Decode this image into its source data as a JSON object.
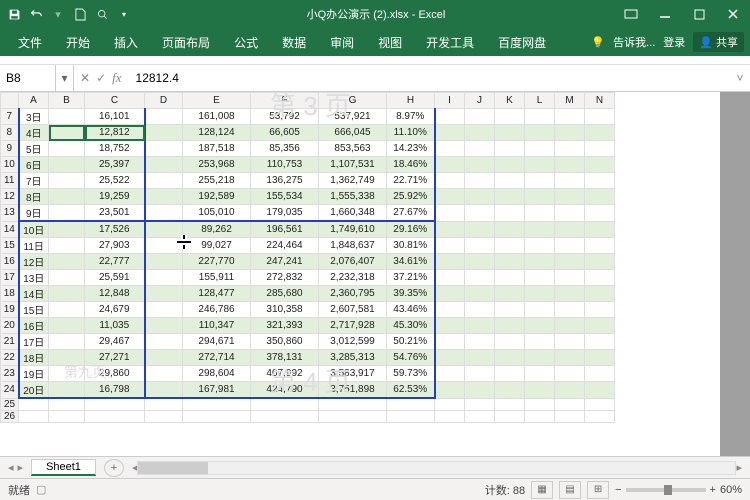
{
  "app": {
    "title": "小Q办公演示 (2).xlsx - Excel"
  },
  "tabs": {
    "file": "文件",
    "home": "开始",
    "insert": "插入",
    "layout": "页面布局",
    "formulas": "公式",
    "data": "数据",
    "review": "审阅",
    "view": "视图",
    "dev": "开发工具",
    "baidu": "百度网盘",
    "tellme": "告诉我...",
    "login": "登录",
    "share": "共享"
  },
  "namebox": "B8",
  "formula": "12812.4",
  "columns": [
    "A",
    "B",
    "C",
    "D",
    "E",
    "F",
    "G",
    "H",
    "I",
    "J",
    "K",
    "L",
    "M",
    "N"
  ],
  "rowNums": [
    7,
    8,
    9,
    10,
    11,
    12,
    13,
    14,
    15,
    16,
    17,
    18,
    19,
    20,
    21,
    22,
    23,
    24,
    25,
    26
  ],
  "rows": [
    {
      "A": "3日",
      "C": "16,101",
      "E": "161,008",
      "F": "53,792",
      "G": "537,921",
      "H": "8.97%",
      "even": false
    },
    {
      "A": "4日",
      "C": "12,812",
      "E": "128,124",
      "F": "66,605",
      "G": "666,045",
      "H": "11.10%",
      "even": true
    },
    {
      "A": "5日",
      "C": "18,752",
      "E": "187,518",
      "F": "85,356",
      "G": "853,563",
      "H": "14.23%",
      "even": false
    },
    {
      "A": "6日",
      "C": "25,397",
      "E": "253,968",
      "F": "110,753",
      "G": "1,107,531",
      "H": "18.46%",
      "even": true
    },
    {
      "A": "7日",
      "C": "25,522",
      "E": "255,218",
      "F": "136,275",
      "G": "1,362,749",
      "H": "22.71%",
      "even": false
    },
    {
      "A": "8日",
      "C": "19,259",
      "E": "192,589",
      "F": "155,534",
      "G": "1,555,338",
      "H": "25.92%",
      "even": true
    },
    {
      "A": "9日",
      "C": "23,501",
      "E": "105,010",
      "F": "179,035",
      "G": "1,660,348",
      "H": "27.67%",
      "even": false
    },
    {
      "A": "10日",
      "C": "17,526",
      "E": "89,262",
      "F": "196,561",
      "G": "1,749,610",
      "H": "29.16%",
      "even": true
    },
    {
      "A": "11日",
      "C": "27,903",
      "E": "99,027",
      "F": "224,464",
      "G": "1,848,637",
      "H": "30.81%",
      "even": false
    },
    {
      "A": "12日",
      "C": "22,777",
      "E": "227,770",
      "F": "247,241",
      "G": "2,076,407",
      "H": "34.61%",
      "even": true
    },
    {
      "A": "13日",
      "C": "25,591",
      "E": "155,911",
      "F": "272,832",
      "G": "2,232,318",
      "H": "37.21%",
      "even": false
    },
    {
      "A": "14日",
      "C": "12,848",
      "E": "128,477",
      "F": "285,680",
      "G": "2,360,795",
      "H": "39.35%",
      "even": true
    },
    {
      "A": "15日",
      "C": "24,679",
      "E": "246,786",
      "F": "310,358",
      "G": "2,607,581",
      "H": "43.46%",
      "even": false
    },
    {
      "A": "16日",
      "C": "11,035",
      "E": "110,347",
      "F": "321,393",
      "G": "2,717,928",
      "H": "45.30%",
      "even": true
    },
    {
      "A": "17日",
      "C": "29,467",
      "E": "294,671",
      "F": "350,860",
      "G": "3,012,599",
      "H": "50.21%",
      "even": false
    },
    {
      "A": "18日",
      "C": "27,271",
      "E": "272,714",
      "F": "378,131",
      "G": "3,285,313",
      "H": "54.76%",
      "even": true
    },
    {
      "A": "19日",
      "C": "29,860",
      "E": "298,604",
      "F": "407,992",
      "G": "3,583,917",
      "H": "59.73%",
      "even": false
    },
    {
      "A": "20日",
      "C": "16,798",
      "E": "167,981",
      "F": "424,790",
      "G": "3,751,898",
      "H": "62.53%",
      "even": true
    }
  ],
  "watermarks": {
    "top": "第 3 页",
    "mid": "第 4 页",
    "left": "第九页"
  },
  "sheetTab": "Sheet1",
  "status": {
    "ready": "就绪",
    "count": "计数: 88",
    "zoom": "60%"
  }
}
